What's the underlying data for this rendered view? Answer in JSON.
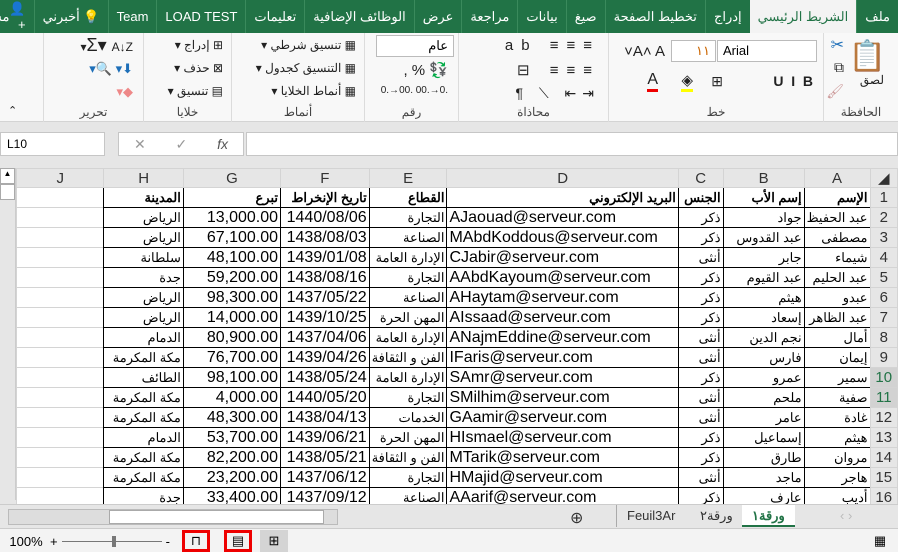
{
  "ribbon_tabs": [
    "ملف",
    "الشريط الرئيسي",
    "إدراج",
    "تخطيط الصفحة",
    "صيغ",
    "بيانات",
    "مراجعة",
    "عرض",
    "الوظائف الإضافية",
    "تعليمات",
    "LOAD TEST",
    "Team"
  ],
  "tell_me": "أخبرني",
  "share": "مشاركة",
  "groups": {
    "clipboard": "الحافظة",
    "paste": "لصق",
    "font": "خط",
    "font_name": "Arial",
    "font_size": "١١",
    "alignment": "محاذاة",
    "number": "رقم",
    "number_format": "عام",
    "styles": "أنماط",
    "conditional": "تنسيق شرطي",
    "as_table": "التنسيق كجدول",
    "cell_styles": "أنماط الخلايا",
    "cells": "خلايا",
    "insert": "إدراج",
    "delete": "حذف",
    "format": "تنسيق",
    "editing": "تحرير"
  },
  "name_box": "L10",
  "fx": "fx",
  "columns": [
    "A",
    "B",
    "C",
    "D",
    "E",
    "F",
    "G",
    "H",
    "J"
  ],
  "headers": [
    "الإسم",
    "إسم الأب",
    "الجنس",
    "البريد الإلكتروني",
    "القطاع",
    "تاريخ الإنخراط",
    "تبرع",
    "المدينة",
    ""
  ],
  "rows": [
    [
      "عبد الحفيظ",
      "جواد",
      "ذكر",
      "AJaouad@serveur.com",
      "التجارة",
      "1440/08/06",
      "13,000.00",
      "الرياض"
    ],
    [
      "مصطفى",
      "عبد القدوس",
      "ذكر",
      "MAbdKoddous@serveur.com",
      "الصناعة",
      "1438/08/03",
      "67,100.00",
      "الرياض"
    ],
    [
      "شيماء",
      "جابر",
      "أنثى",
      "CJabir@serveur.com",
      "الإدارة العامة",
      "1439/01/08",
      "48,100.00",
      "سلطانة"
    ],
    [
      "عبد الحليم",
      "عبد القيوم",
      "ذكر",
      "AAbdKayoum@serveur.com",
      "التجارة",
      "1438/08/16",
      "59,200.00",
      "جدة"
    ],
    [
      "عبدو",
      "هيثم",
      "ذكر",
      "AHaytam@serveur.com",
      "الصناعة",
      "1437/05/22",
      "98,300.00",
      "الرياض"
    ],
    [
      "عبد الظاهر",
      "إسعاد",
      "ذكر",
      "AIssaad@serveur.com",
      "المهن الحرة",
      "1439/10/25",
      "14,000.00",
      "الرياض"
    ],
    [
      "أمال",
      "نجم الدين",
      "أنثى",
      "ANajmEddine@serveur.com",
      "الإدارة العامة",
      "1437/04/06",
      "80,900.00",
      "الدمام"
    ],
    [
      "إيمان",
      "فارس",
      "أنثى",
      "IFaris@serveur.com",
      "الفن و الثقافة",
      "1439/04/26",
      "76,700.00",
      "مكة المكرمة"
    ],
    [
      "سمير",
      "عمرو",
      "ذكر",
      "SAmr@serveur.com",
      "الإدارة العامة",
      "1438/05/24",
      "98,100.00",
      "الطائف"
    ],
    [
      "صفية",
      "ملحم",
      "أنثى",
      "SMilhim@serveur.com",
      "التجارة",
      "1440/05/20",
      "4,000.00",
      "مكة المكرمة"
    ],
    [
      "غادة",
      "عامر",
      "أنثى",
      "GAamir@serveur.com",
      "الخدمات",
      "1438/04/13",
      "48,300.00",
      "مكة المكرمة"
    ],
    [
      "هيثم",
      "إسماعيل",
      "ذكر",
      "HIsmael@serveur.com",
      "المهن الحرة",
      "1439/06/21",
      "53,700.00",
      "الدمام"
    ],
    [
      "مروان",
      "طارق",
      "ذكر",
      "MTarik@serveur.com",
      "الفن و الثقافة",
      "1438/05/21",
      "82,200.00",
      "مكة المكرمة"
    ],
    [
      "هاجر",
      "ماجد",
      "أنثى",
      "HMajid@serveur.com",
      "التجارة",
      "1437/06/12",
      "23,200.00",
      "مكة المكرمة"
    ],
    [
      "أديب",
      "عارف",
      "ذكر",
      "AAarif@serveur.com",
      "الصناعة",
      "1437/09/12",
      "33,400.00",
      "جدة"
    ]
  ],
  "sheets": [
    "ورقة١",
    "ورقة٢",
    "Feuil3Ar"
  ],
  "zoom": "100%"
}
